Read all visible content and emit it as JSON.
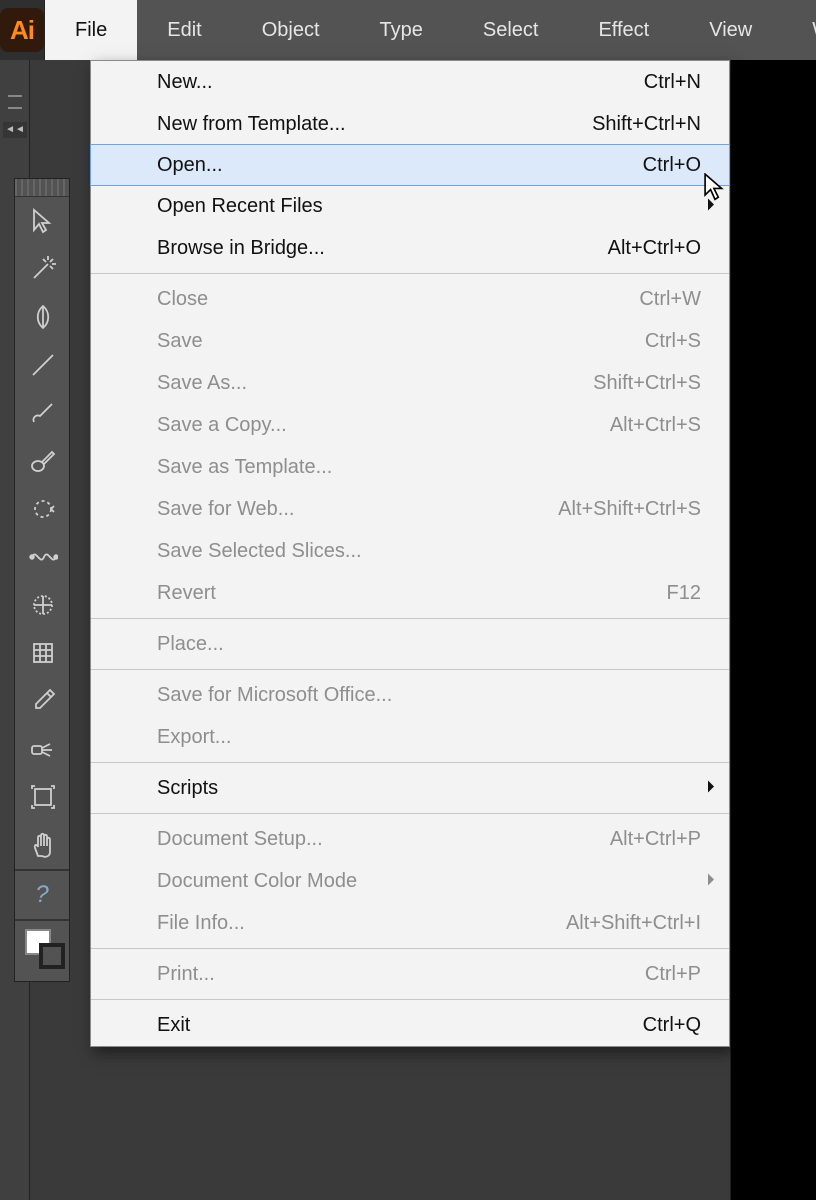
{
  "app": {
    "logo_text": "Ai"
  },
  "menubar": [
    "File",
    "Edit",
    "Object",
    "Type",
    "Select",
    "Effect",
    "View",
    "Window"
  ],
  "sidestrip": {
    "collapse_glyph": "◄◄"
  },
  "dropdown": {
    "groups": [
      [
        {
          "label": "New...",
          "shortcut": "Ctrl+N",
          "disabled": false,
          "submenu": false,
          "selected": false
        },
        {
          "label": "New from Template...",
          "shortcut": "Shift+Ctrl+N",
          "disabled": false,
          "submenu": false,
          "selected": false
        },
        {
          "label": "Open...",
          "shortcut": "Ctrl+O",
          "disabled": false,
          "submenu": false,
          "selected": true
        },
        {
          "label": "Open Recent Files",
          "shortcut": "",
          "disabled": false,
          "submenu": true,
          "selected": false
        },
        {
          "label": "Browse in Bridge...",
          "shortcut": "Alt+Ctrl+O",
          "disabled": false,
          "submenu": false,
          "selected": false
        }
      ],
      [
        {
          "label": "Close",
          "shortcut": "Ctrl+W",
          "disabled": true,
          "submenu": false,
          "selected": false
        },
        {
          "label": "Save",
          "shortcut": "Ctrl+S",
          "disabled": true,
          "submenu": false,
          "selected": false
        },
        {
          "label": "Save As...",
          "shortcut": "Shift+Ctrl+S",
          "disabled": true,
          "submenu": false,
          "selected": false
        },
        {
          "label": "Save a Copy...",
          "shortcut": "Alt+Ctrl+S",
          "disabled": true,
          "submenu": false,
          "selected": false
        },
        {
          "label": "Save as Template...",
          "shortcut": "",
          "disabled": true,
          "submenu": false,
          "selected": false
        },
        {
          "label": "Save for Web...",
          "shortcut": "Alt+Shift+Ctrl+S",
          "disabled": true,
          "submenu": false,
          "selected": false
        },
        {
          "label": "Save Selected Slices...",
          "shortcut": "",
          "disabled": true,
          "submenu": false,
          "selected": false
        },
        {
          "label": "Revert",
          "shortcut": "F12",
          "disabled": true,
          "submenu": false,
          "selected": false
        }
      ],
      [
        {
          "label": "Place...",
          "shortcut": "",
          "disabled": true,
          "submenu": false,
          "selected": false
        }
      ],
      [
        {
          "label": "Save for Microsoft Office...",
          "shortcut": "",
          "disabled": true,
          "submenu": false,
          "selected": false
        },
        {
          "label": "Export...",
          "shortcut": "",
          "disabled": true,
          "submenu": false,
          "selected": false
        }
      ],
      [
        {
          "label": "Scripts",
          "shortcut": "",
          "disabled": false,
          "submenu": true,
          "selected": false
        }
      ],
      [
        {
          "label": "Document Setup...",
          "shortcut": "Alt+Ctrl+P",
          "disabled": true,
          "submenu": false,
          "selected": false
        },
        {
          "label": "Document Color Mode",
          "shortcut": "",
          "disabled": true,
          "submenu": true,
          "selected": false
        },
        {
          "label": "File Info...",
          "shortcut": "Alt+Shift+Ctrl+I",
          "disabled": true,
          "submenu": false,
          "selected": false
        }
      ],
      [
        {
          "label": "Print...",
          "shortcut": "Ctrl+P",
          "disabled": true,
          "submenu": false,
          "selected": false
        }
      ],
      [
        {
          "label": "Exit",
          "shortcut": "Ctrl+Q",
          "disabled": false,
          "submenu": false,
          "selected": false
        }
      ]
    ]
  },
  "tools": [
    "selection",
    "magic-wand",
    "pen",
    "line",
    "brush",
    "blob-brush",
    "rotate",
    "warp",
    "free-transform",
    "mesh",
    "eyedropper",
    "symbol-sprayer",
    "artboard",
    "hand"
  ],
  "help_glyph": "?"
}
